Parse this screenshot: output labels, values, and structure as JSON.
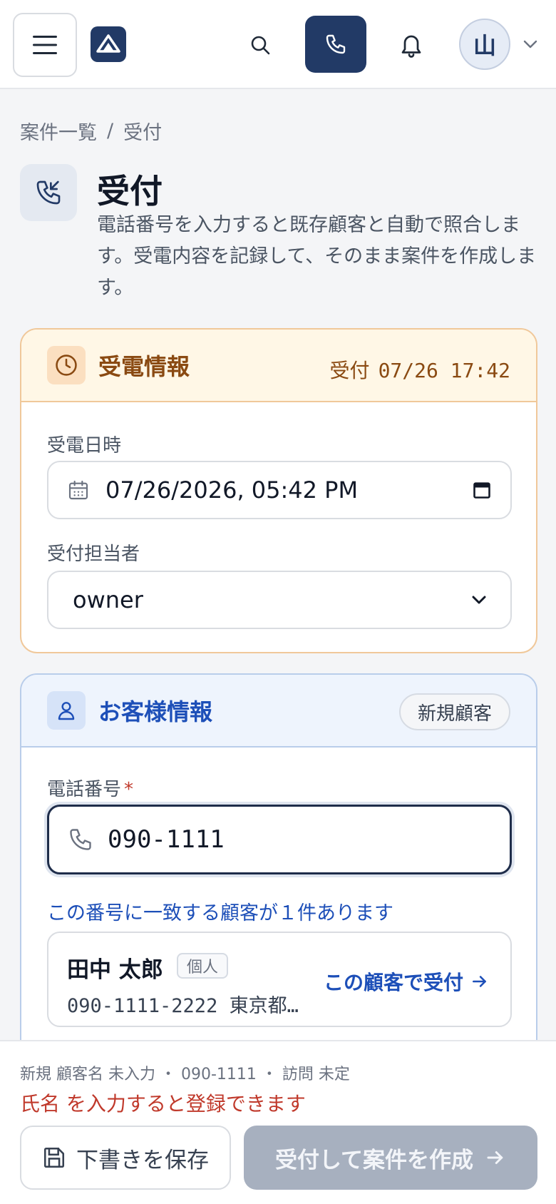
{
  "topbar": {
    "avatar_initial": "山"
  },
  "breadcrumb": {
    "parent": "案件一覧",
    "separator": "/",
    "current": "受付"
  },
  "page": {
    "title": "受付",
    "description": "電話番号を入力すると既存顧客と自動で照合します。受電内容を記録して、そのまま案件を作成します。"
  },
  "receive_card": {
    "title": "受電情報",
    "stamp_label": "受付",
    "stamp_value": "07/26 17:42",
    "datetime_label": "受電日時",
    "datetime_value": "07/26/2026, 05:42 PM",
    "staff_label": "受付担当者",
    "staff_value": "owner"
  },
  "customer_card": {
    "title": "お客様情報",
    "badge": "新規顧客",
    "phone_label": "電話番号",
    "required_mark": "*",
    "phone_value": "090-1111",
    "match_note": "この番号に一致する顧客が１件あります",
    "match": {
      "name": "田中 太郎",
      "type": "個人",
      "detail": "090-1111-2222 東京都…",
      "action": "この顧客で受付"
    }
  },
  "footer": {
    "summary": "新規 顧客名 未入力 ・ 090-1111 ・ 訪問 未定",
    "warning": "氏名 を入力すると登録できます",
    "draft_label": "下書きを保存",
    "create_label": "受付して案件を作成"
  },
  "colors": {
    "brand": "#223a66",
    "receive_accent": "#8a4a12",
    "customer_accent": "#1d4fb8",
    "warning": "#c0392b",
    "disabled_button": "#a7b0bf"
  },
  "icons": [
    "menu-icon",
    "logo-icon",
    "search-icon",
    "phone-icon",
    "bell-icon",
    "chevron-down-icon",
    "phone-incoming-icon",
    "clock-icon",
    "calendar-icon",
    "user-icon",
    "arrow-right-icon",
    "save-icon"
  ]
}
